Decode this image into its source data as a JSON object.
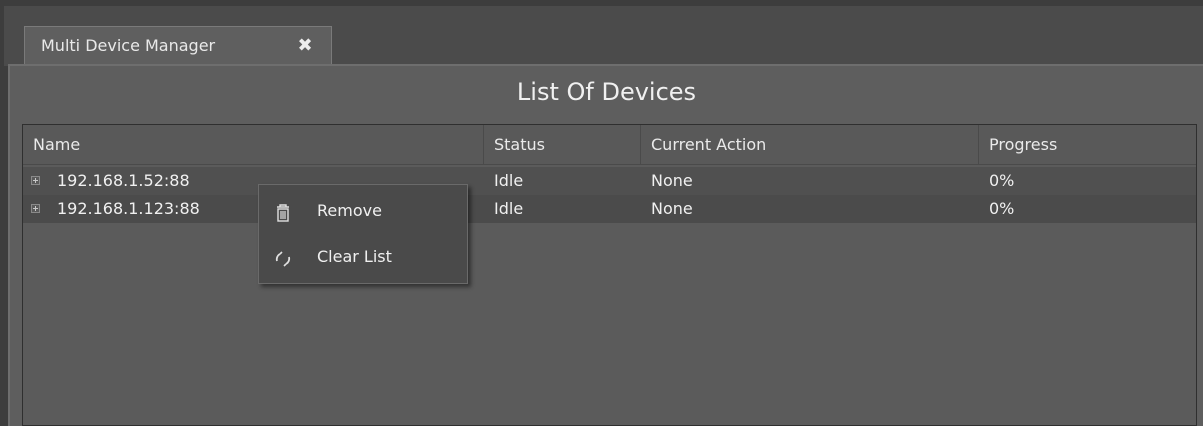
{
  "tab": {
    "title": "Multi Device Manager",
    "close_glyph": "✖"
  },
  "panel": {
    "title": "List Of Devices"
  },
  "table": {
    "columns": [
      "Name",
      "Status",
      "Current Action",
      "Progress"
    ],
    "rows": [
      {
        "name": "192.168.1.52:88",
        "status": "Idle",
        "action": "None",
        "progress": "0%"
      },
      {
        "name": "192.168.1.123:88",
        "status": "Idle",
        "action": "None",
        "progress": "0%"
      }
    ]
  },
  "context_menu": {
    "items": [
      {
        "label": "Remove",
        "icon": "trash-icon"
      },
      {
        "label": "Clear List",
        "icon": "refresh-icon"
      }
    ]
  },
  "colors": {
    "background": "#3d3d3d",
    "panel": "#5e5e5e",
    "text": "#f0f0f0"
  }
}
